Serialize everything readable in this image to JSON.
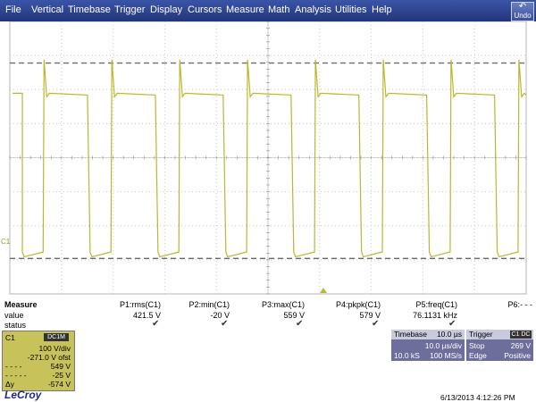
{
  "menu": [
    "File",
    "Vertical",
    "Timebase",
    "Trigger",
    "Display",
    "Cursors",
    "Measure",
    "Math",
    "Analysis",
    "Utilities",
    "Help"
  ],
  "undo_label": "Undo",
  "colors": {
    "trace": "#b8b830",
    "menubar": "#2c3f8c",
    "channel_box": "#c7c25a",
    "panel": "#6d6e9b"
  },
  "waveform": {
    "volts_per_div": 100,
    "offset_v": -271.0,
    "high_v": 549,
    "low_v": -25,
    "time_per_div_us": 10.0,
    "freq_khz": 76.1131,
    "rms_v": 421.5,
    "min_v": -20,
    "max_v": 559,
    "pkpk_v": 579
  },
  "channel_marker": "C1",
  "measure": {
    "title": "Measure",
    "row_value": "value",
    "row_status": "status",
    "params": [
      {
        "name": "P1:rms(C1)",
        "value": "421.5 V",
        "ok": true
      },
      {
        "name": "P2:min(C1)",
        "value": "-20 V",
        "ok": true
      },
      {
        "name": "P3:max(C1)",
        "value": "559 V",
        "ok": true
      },
      {
        "name": "P4:pkpk(C1)",
        "value": "579 V",
        "ok": true
      },
      {
        "name": "P5:freq(C1)",
        "value": "76.1131 kHz",
        "ok": true
      },
      {
        "name": "P6:- - -",
        "value": "",
        "ok": false
      }
    ]
  },
  "channel_box": {
    "name": "C1",
    "tag": "DC1M",
    "vdiv": "100 V/div",
    "offset": "-271.0 V ofst",
    "cursor1_value": "549 V",
    "cursor2_value": "-25 V",
    "delta_label": "Δy",
    "delta_value": "-574 V"
  },
  "timebase": {
    "title": "Timebase",
    "title_value": "10.0 µs",
    "div": "10.0 µs/div",
    "samples": "10.0 kS",
    "rate": "100 MS/s"
  },
  "trigger": {
    "title": "Trigger",
    "tag": "C1 DC",
    "mode": "Stop",
    "level": "269 V",
    "type": "Edge",
    "slope": "Positive"
  },
  "brand": "LeCroy",
  "datetime": "6/13/2013 4:12:26 PM"
}
